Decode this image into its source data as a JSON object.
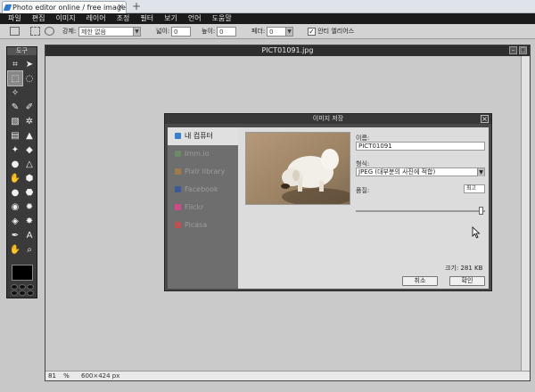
{
  "browser": {
    "tab_title": "Photo editor online / free image edi…",
    "tab_close": "×",
    "new_tab": "+"
  },
  "menu": [
    "파일",
    "편집",
    "이미지",
    "레이어",
    "조정",
    "필터",
    "보기",
    "언어",
    "도움말"
  ],
  "options": {
    "limit_label": "강제:",
    "limit_value": "제한 없음",
    "width_label": "넓이:",
    "width_value": "0",
    "height_label": "높이:",
    "height_value": "0",
    "feather_label": "페더:",
    "feather_value": "0",
    "antialias_label": "안티 엘리어스",
    "antialias_checked": true
  },
  "tools": {
    "title": "도구",
    "items": [
      {
        "name": "crop-icon",
        "glyph": "⌗"
      },
      {
        "name": "move-icon",
        "glyph": "➤"
      },
      {
        "name": "marquee-icon",
        "glyph": "⬚"
      },
      {
        "name": "lasso-icon",
        "glyph": "◌"
      },
      {
        "name": "wand-icon",
        "glyph": "✧"
      },
      {
        "name": "blank-icon",
        "glyph": ""
      },
      {
        "name": "pencil-icon",
        "glyph": "✎"
      },
      {
        "name": "brush-icon",
        "glyph": "✐"
      },
      {
        "name": "eraser-icon",
        "glyph": "▧"
      },
      {
        "name": "spray-icon",
        "glyph": "✲"
      },
      {
        "name": "gradient-icon",
        "glyph": "▤"
      },
      {
        "name": "bucket-icon",
        "glyph": "▲"
      },
      {
        "name": "clone-icon",
        "glyph": "✦"
      },
      {
        "name": "shape-icon",
        "glyph": "◆"
      },
      {
        "name": "blur-icon",
        "glyph": "●"
      },
      {
        "name": "sharpen-icon",
        "glyph": "△"
      },
      {
        "name": "smudge-icon",
        "glyph": "✋"
      },
      {
        "name": "sponge-icon",
        "glyph": "⬢"
      },
      {
        "name": "dodge-icon",
        "glyph": "●"
      },
      {
        "name": "burn-icon",
        "glyph": "⬣"
      },
      {
        "name": "redeye-icon",
        "glyph": "◉"
      },
      {
        "name": "spot-icon",
        "glyph": "✹"
      },
      {
        "name": "bloat-icon",
        "glyph": "◈"
      },
      {
        "name": "pinch-icon",
        "glyph": "✸"
      },
      {
        "name": "picker-icon",
        "glyph": "✒"
      },
      {
        "name": "text-icon",
        "glyph": "A"
      },
      {
        "name": "hand-icon",
        "glyph": "✋"
      },
      {
        "name": "zoom-icon",
        "glyph": "⌕"
      }
    ]
  },
  "document": {
    "title": "PICT01091.jpg",
    "zoom": "81",
    "zoom_unit": "%",
    "dimensions": "600×424 px"
  },
  "dialog": {
    "title": "이미지 저장",
    "close": "×",
    "sources": [
      {
        "label": "내 컴퓨터",
        "active": true,
        "color": "#3a7ed0"
      },
      {
        "label": "Imm.io",
        "active": false,
        "color": "#6a8a6a"
      },
      {
        "label": "Pixlr library",
        "active": false,
        "color": "#a07a4a"
      },
      {
        "label": "Facebook",
        "active": false,
        "color": "#3b5998"
      },
      {
        "label": "Flickr",
        "active": false,
        "color": "#d04a8a"
      },
      {
        "label": "Picasa",
        "active": false,
        "color": "#c05050"
      }
    ],
    "name_label": "이름:",
    "name_value": "PICT01091",
    "format_label": "형식:",
    "format_value": "JPEG (대부분의 사진에 적합)",
    "quality_label": "품질:",
    "quality_value": "최고",
    "quality_level": 0.97,
    "size_text": "크기: 281 KB",
    "cancel_label": "취소",
    "ok_label": "확인"
  }
}
